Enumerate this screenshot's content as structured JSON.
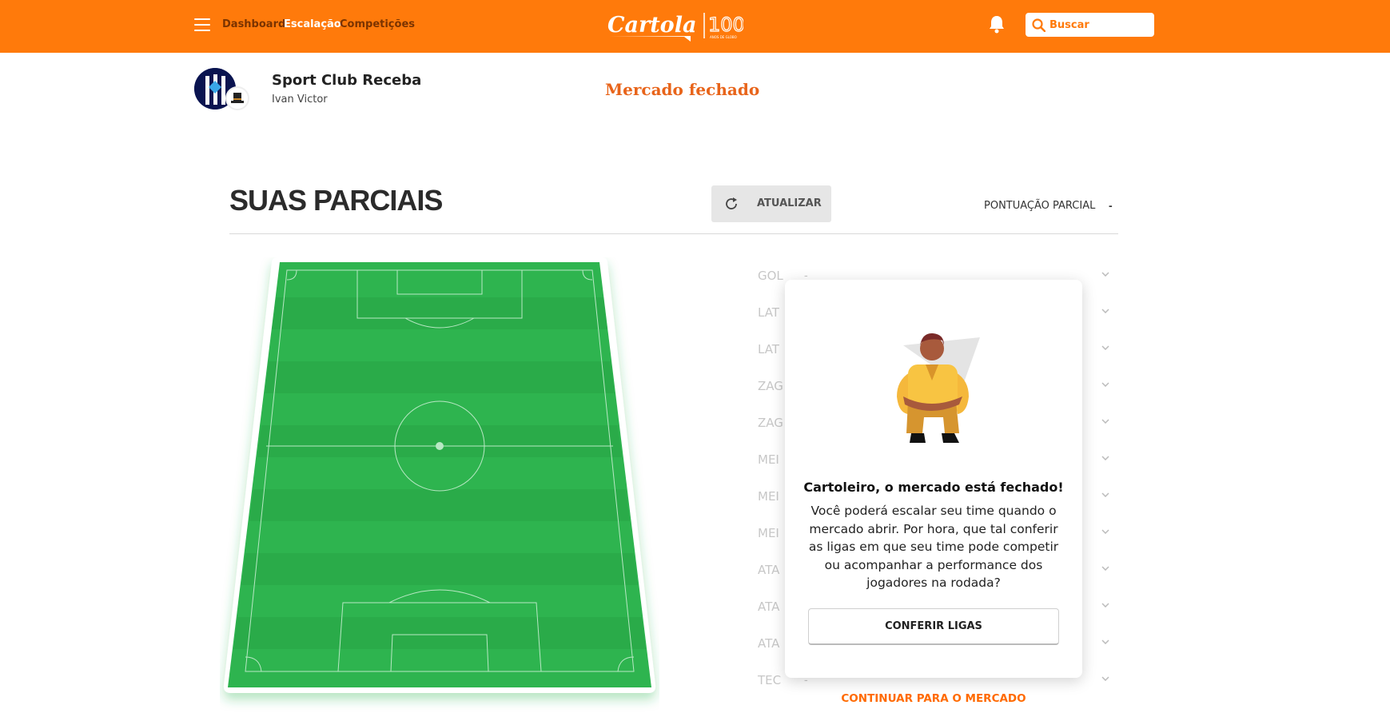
{
  "header": {
    "nav": [
      "Dashboard",
      "Escalação",
      "Competições"
    ],
    "logo_text": "Cartola",
    "logo_badge": "100",
    "logo_caption": "ANOS DE GLOBO",
    "search_placeholder": "Buscar"
  },
  "team": {
    "name": "Sport Club Receba",
    "owner": "Ivan Victor",
    "market_status": "Mercado fechado"
  },
  "section": {
    "title": "SUAS PARCIAIS",
    "refresh_label": "ATUALIZAR",
    "partial_label": "PONTUAÇÃO PARCIAL",
    "partial_value": "-"
  },
  "positions": [
    {
      "label": "GOL",
      "value": "-"
    },
    {
      "label": "LAT",
      "value": "-"
    },
    {
      "label": "LAT",
      "value": "-"
    },
    {
      "label": "ZAG",
      "value": "-"
    },
    {
      "label": "ZAG",
      "value": "-"
    },
    {
      "label": "MEI",
      "value": "-"
    },
    {
      "label": "MEI",
      "value": "-"
    },
    {
      "label": "MEI",
      "value": "-"
    },
    {
      "label": "ATA",
      "value": "-"
    },
    {
      "label": "ATA",
      "value": "-"
    },
    {
      "label": "ATA",
      "value": "-"
    },
    {
      "label": "TEC",
      "value": "-"
    }
  ],
  "market_card": {
    "title": "Cartoleiro, o mercado está fechado!",
    "text": "Você poderá escalar seu time quando o mercado abrir. Por hora, que tal conferir as ligas em que seu time pode competir ou acompanhar a performance dos jogadores na rodada?",
    "button": "CONFERIR LIGAS",
    "continue_link": "CONTINUAR PARA O MERCADO"
  },
  "colors": {
    "brand_orange": "#ff7a0b",
    "field_green": "#2eb44f",
    "market_status": "#e8641a"
  }
}
